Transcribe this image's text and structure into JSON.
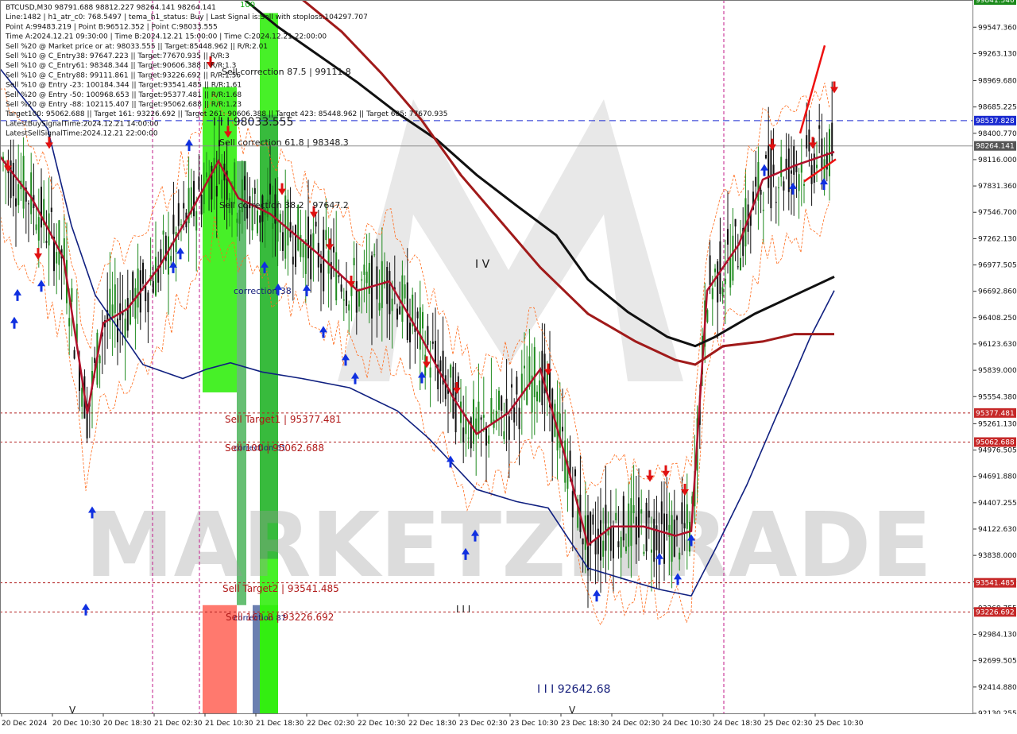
{
  "chart_data": {
    "type": "line",
    "symbol": "BTCUSD,M30",
    "watermark": "MARKETZITRADE",
    "info_lines": [
      "BTCUSD,M30  98791.688 98812.227 98264.141 98264.141",
      "Line:1482 | h1_atr_c0: 768.5497 | tema_h1_status: Buy | Last Signal is:Sell with stoploss:104297.707",
      "Point A:99483.219 | Point B:96512.352 | Point C:98033.555",
      "Time A:2024.12.21 09:30:00 | Time B:2024.12.21 15:00:00 | Time C:2024.12.21 22:00:00",
      "Sell %20 @ Market price or at: 98033.555 || Target:85448.962 || R/R:2.01",
      "Sell %10 @ C_Entry38: 97647.223 || Target:77670.935 || R/R:3",
      "Sell %10 @ C_Entry61: 98348.344 || Target:90606.388 || R/R:1.3",
      "Sell %10 @ C_Entry88: 99111.861 || Target:93226.692 || R/R:1.56",
      "Sell %10 @ Entry -23: 100184.344 || Target:93541.485 || R/R:1.61",
      "Sell %20 @ Entry -50: 100968.653 || Target:95377.481 || R/R:1.68",
      "Sell %20 @ Entry -88: 102115.407 || Target:95062.688 || R/R:1.23",
      "Target100: 95062.688 || Target 161: 93226.692 || Target 261: 90606.388 || Target 423: 85448.962 || Target 685: 77670.935",
      "LatestBuySignalTime:2024.12.21 14:00:00",
      "LatestSellSignalTime:2024.12.21 22:00:00"
    ],
    "y_ticks": [
      "99547.360",
      "99263.130",
      "98969.680",
      "98685.225",
      "98400.770",
      "98116.000",
      "97831.360",
      "97546.700",
      "97262.130",
      "96977.505",
      "96692.860",
      "96408.250",
      "96123.630",
      "95839.000",
      "95554.380",
      "95261.130",
      "94976.505",
      "94691.880",
      "94407.255",
      "94122.630",
      "93838.000",
      "93553.380",
      "93268.755",
      "92984.130",
      "92699.505",
      "92414.880",
      "92130.255"
    ],
    "x_ticks": [
      "20 Dec 2024",
      "20 Dec 10:30",
      "20 Dec 18:30",
      "21 Dec 02:30",
      "21 Dec 10:30",
      "21 Dec 18:30",
      "22 Dec 02:30",
      "22 Dec 10:30",
      "22 Dec 18:30",
      "23 Dec 02:30",
      "23 Dec 10:30",
      "23 Dec 18:30",
      "24 Dec 02:30",
      "24 Dec 10:30",
      "24 Dec 18:30",
      "25 Dec 02:30",
      "25 Dec 10:30"
    ],
    "ylim": [
      92130.255,
      99841.54
    ],
    "top_label": "99841.540",
    "current_price": "98264.141",
    "point_c_level": "98537.828",
    "levels": [
      {
        "name": "Sell Target1",
        "value": 95377.481,
        "tag": "95377.481",
        "text": "Sell Target1 | 95377.481"
      },
      {
        "name": "Sell 100",
        "value": 95062.688,
        "tag": "95062.688",
        "text": "Sell 100 | 95062.688"
      },
      {
        "name": "Sell Target2",
        "value": 93541.485,
        "tag": "93541.485",
        "text": "Sell Target2 | 93541.485"
      },
      {
        "name": "Sell 161.8",
        "value": 93226.692,
        "tag": "93226.692",
        "text": "Sell 161.8 | 93226.692"
      }
    ],
    "annotations": [
      {
        "text": "Sell correction 87.5 | 99111.8",
        "price": 99111.8,
        "color": "#1a1a1a"
      },
      {
        "text": "I I I 98033.555",
        "price": 98033.555,
        "color": "#1a1a1a"
      },
      {
        "text": "Sell correction 61.8 | 98348.3",
        "price": 98348.3,
        "color": "#1a1a1a"
      },
      {
        "text": "Sell correction 38.2 | 97647.2",
        "price": 97647.2,
        "color": "#1a1a1a"
      },
      {
        "text": "correction 38",
        "price": 96650,
        "color": "#1a237e"
      },
      {
        "text": "correction 61",
        "price": 94960,
        "color": "#1a237e"
      },
      {
        "text": "correction 87",
        "price": 93130,
        "color": "#1a237e"
      },
      {
        "text": "I V",
        "price": 96950,
        "color": "#1a1a1a"
      },
      {
        "text": "I I I 92642.68",
        "price": 92280,
        "color": "#1a237e"
      },
      {
        "text": "I I I",
        "price": 93290,
        "color": "#1a1a1a"
      },
      {
        "text": "V",
        "price": 92100,
        "color": "#1a1a1a"
      },
      {
        "text": "V",
        "price": 92100,
        "color": "#1a1a1a"
      },
      {
        "text": "100",
        "price": 99700,
        "color": "#00aa00"
      }
    ],
    "series": [
      {
        "name": "fast",
        "color": "#b0102a",
        "points": [
          [
            0,
            98150
          ],
          [
            40,
            97700
          ],
          [
            80,
            97050
          ],
          [
            110,
            95370
          ],
          [
            130,
            96350
          ],
          [
            160,
            96500
          ],
          [
            200,
            96950
          ],
          [
            240,
            97550
          ],
          [
            275,
            98100
          ],
          [
            300,
            97700
          ],
          [
            340,
            97530
          ],
          [
            400,
            97100
          ],
          [
            450,
            96700
          ],
          [
            490,
            96800
          ],
          [
            530,
            96200
          ],
          [
            570,
            95550
          ],
          [
            600,
            95150
          ],
          [
            640,
            95380
          ],
          [
            680,
            95850
          ],
          [
            710,
            94950
          ],
          [
            740,
            93950
          ],
          [
            770,
            94150
          ],
          [
            810,
            94150
          ],
          [
            850,
            94050
          ],
          [
            870,
            94100
          ],
          [
            890,
            96700
          ],
          [
            930,
            97200
          ],
          [
            960,
            97900
          ],
          [
            1000,
            98050
          ],
          [
            1050,
            98200
          ]
        ]
      },
      {
        "name": "mid",
        "color": "#102080",
        "points": [
          [
            0,
            99100
          ],
          [
            60,
            98450
          ],
          [
            90,
            97400
          ],
          [
            120,
            96650
          ],
          [
            180,
            95900
          ],
          [
            230,
            95750
          ],
          [
            260,
            95850
          ],
          [
            290,
            95920
          ],
          [
            330,
            95820
          ],
          [
            380,
            95750
          ],
          [
            440,
            95650
          ],
          [
            500,
            95400
          ],
          [
            540,
            95100
          ],
          [
            600,
            94550
          ],
          [
            650,
            94420
          ],
          [
            690,
            94350
          ],
          [
            740,
            93700
          ],
          [
            790,
            93570
          ],
          [
            830,
            93470
          ],
          [
            870,
            93400
          ],
          [
            900,
            93900
          ],
          [
            940,
            94600
          ],
          [
            980,
            95400
          ],
          [
            1020,
            96200
          ],
          [
            1050,
            96700
          ]
        ]
      },
      {
        "name": "slow_black",
        "color": "#111111",
        "points": [
          [
            300,
            99900
          ],
          [
            350,
            99550
          ],
          [
            400,
            99250
          ],
          [
            450,
            98950
          ],
          [
            500,
            98620
          ],
          [
            550,
            98330
          ],
          [
            600,
            97950
          ],
          [
            650,
            97620
          ],
          [
            700,
            97300
          ],
          [
            740,
            96820
          ],
          [
            790,
            96470
          ],
          [
            840,
            96200
          ],
          [
            875,
            96100
          ],
          [
            900,
            96200
          ],
          [
            950,
            96450
          ],
          [
            1000,
            96650
          ],
          [
            1050,
            96850
          ]
        ]
      },
      {
        "name": "slow_red",
        "color": "#a01a1a",
        "points": [
          [
            380,
            99850
          ],
          [
            430,
            99500
          ],
          [
            480,
            99050
          ],
          [
            530,
            98550
          ],
          [
            580,
            97950
          ],
          [
            630,
            97450
          ],
          [
            680,
            96950
          ],
          [
            740,
            96450
          ],
          [
            800,
            96150
          ],
          [
            850,
            95950
          ],
          [
            875,
            95900
          ],
          [
            910,
            96100
          ],
          [
            960,
            96150
          ],
          [
            1000,
            96230
          ],
          [
            1050,
            96230
          ]
        ]
      }
    ],
    "zones": [
      {
        "name": "zone-green-1",
        "color": "#33ee11",
        "from": 95600,
        "to": 98900
      },
      {
        "name": "zone-green-2",
        "color": "#33aa44",
        "from": 93300,
        "to": 98100
      },
      {
        "name": "zone-red-1",
        "color": "#ff6a5e",
        "from": 92130,
        "to": 93300
      },
      {
        "name": "zone-green-3",
        "color": "#33ee11",
        "from": 92130,
        "to": 99700
      },
      {
        "name": "zone-green-4",
        "color": "#33aa44",
        "from": 93800,
        "to": 98600
      }
    ]
  }
}
